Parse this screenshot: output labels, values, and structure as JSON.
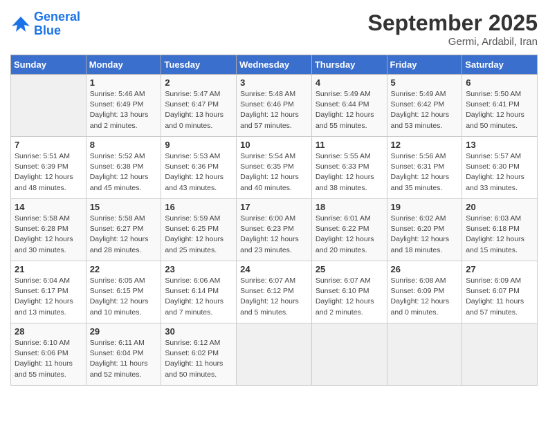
{
  "header": {
    "logo_line1": "General",
    "logo_line2": "Blue",
    "month": "September 2025",
    "location": "Germi, Ardabil, Iran"
  },
  "weekdays": [
    "Sunday",
    "Monday",
    "Tuesday",
    "Wednesday",
    "Thursday",
    "Friday",
    "Saturday"
  ],
  "weeks": [
    [
      {
        "day": "",
        "info": ""
      },
      {
        "day": "1",
        "info": "Sunrise: 5:46 AM\nSunset: 6:49 PM\nDaylight: 13 hours\nand 2 minutes."
      },
      {
        "day": "2",
        "info": "Sunrise: 5:47 AM\nSunset: 6:47 PM\nDaylight: 13 hours\nand 0 minutes."
      },
      {
        "day": "3",
        "info": "Sunrise: 5:48 AM\nSunset: 6:46 PM\nDaylight: 12 hours\nand 57 minutes."
      },
      {
        "day": "4",
        "info": "Sunrise: 5:49 AM\nSunset: 6:44 PM\nDaylight: 12 hours\nand 55 minutes."
      },
      {
        "day": "5",
        "info": "Sunrise: 5:49 AM\nSunset: 6:42 PM\nDaylight: 12 hours\nand 53 minutes."
      },
      {
        "day": "6",
        "info": "Sunrise: 5:50 AM\nSunset: 6:41 PM\nDaylight: 12 hours\nand 50 minutes."
      }
    ],
    [
      {
        "day": "7",
        "info": "Sunrise: 5:51 AM\nSunset: 6:39 PM\nDaylight: 12 hours\nand 48 minutes."
      },
      {
        "day": "8",
        "info": "Sunrise: 5:52 AM\nSunset: 6:38 PM\nDaylight: 12 hours\nand 45 minutes."
      },
      {
        "day": "9",
        "info": "Sunrise: 5:53 AM\nSunset: 6:36 PM\nDaylight: 12 hours\nand 43 minutes."
      },
      {
        "day": "10",
        "info": "Sunrise: 5:54 AM\nSunset: 6:35 PM\nDaylight: 12 hours\nand 40 minutes."
      },
      {
        "day": "11",
        "info": "Sunrise: 5:55 AM\nSunset: 6:33 PM\nDaylight: 12 hours\nand 38 minutes."
      },
      {
        "day": "12",
        "info": "Sunrise: 5:56 AM\nSunset: 6:31 PM\nDaylight: 12 hours\nand 35 minutes."
      },
      {
        "day": "13",
        "info": "Sunrise: 5:57 AM\nSunset: 6:30 PM\nDaylight: 12 hours\nand 33 minutes."
      }
    ],
    [
      {
        "day": "14",
        "info": "Sunrise: 5:58 AM\nSunset: 6:28 PM\nDaylight: 12 hours\nand 30 minutes."
      },
      {
        "day": "15",
        "info": "Sunrise: 5:58 AM\nSunset: 6:27 PM\nDaylight: 12 hours\nand 28 minutes."
      },
      {
        "day": "16",
        "info": "Sunrise: 5:59 AM\nSunset: 6:25 PM\nDaylight: 12 hours\nand 25 minutes."
      },
      {
        "day": "17",
        "info": "Sunrise: 6:00 AM\nSunset: 6:23 PM\nDaylight: 12 hours\nand 23 minutes."
      },
      {
        "day": "18",
        "info": "Sunrise: 6:01 AM\nSunset: 6:22 PM\nDaylight: 12 hours\nand 20 minutes."
      },
      {
        "day": "19",
        "info": "Sunrise: 6:02 AM\nSunset: 6:20 PM\nDaylight: 12 hours\nand 18 minutes."
      },
      {
        "day": "20",
        "info": "Sunrise: 6:03 AM\nSunset: 6:18 PM\nDaylight: 12 hours\nand 15 minutes."
      }
    ],
    [
      {
        "day": "21",
        "info": "Sunrise: 6:04 AM\nSunset: 6:17 PM\nDaylight: 12 hours\nand 13 minutes."
      },
      {
        "day": "22",
        "info": "Sunrise: 6:05 AM\nSunset: 6:15 PM\nDaylight: 12 hours\nand 10 minutes."
      },
      {
        "day": "23",
        "info": "Sunrise: 6:06 AM\nSunset: 6:14 PM\nDaylight: 12 hours\nand 7 minutes."
      },
      {
        "day": "24",
        "info": "Sunrise: 6:07 AM\nSunset: 6:12 PM\nDaylight: 12 hours\nand 5 minutes."
      },
      {
        "day": "25",
        "info": "Sunrise: 6:07 AM\nSunset: 6:10 PM\nDaylight: 12 hours\nand 2 minutes."
      },
      {
        "day": "26",
        "info": "Sunrise: 6:08 AM\nSunset: 6:09 PM\nDaylight: 12 hours\nand 0 minutes."
      },
      {
        "day": "27",
        "info": "Sunrise: 6:09 AM\nSunset: 6:07 PM\nDaylight: 11 hours\nand 57 minutes."
      }
    ],
    [
      {
        "day": "28",
        "info": "Sunrise: 6:10 AM\nSunset: 6:06 PM\nDaylight: 11 hours\nand 55 minutes."
      },
      {
        "day": "29",
        "info": "Sunrise: 6:11 AM\nSunset: 6:04 PM\nDaylight: 11 hours\nand 52 minutes."
      },
      {
        "day": "30",
        "info": "Sunrise: 6:12 AM\nSunset: 6:02 PM\nDaylight: 11 hours\nand 50 minutes."
      },
      {
        "day": "",
        "info": ""
      },
      {
        "day": "",
        "info": ""
      },
      {
        "day": "",
        "info": ""
      },
      {
        "day": "",
        "info": ""
      }
    ]
  ]
}
